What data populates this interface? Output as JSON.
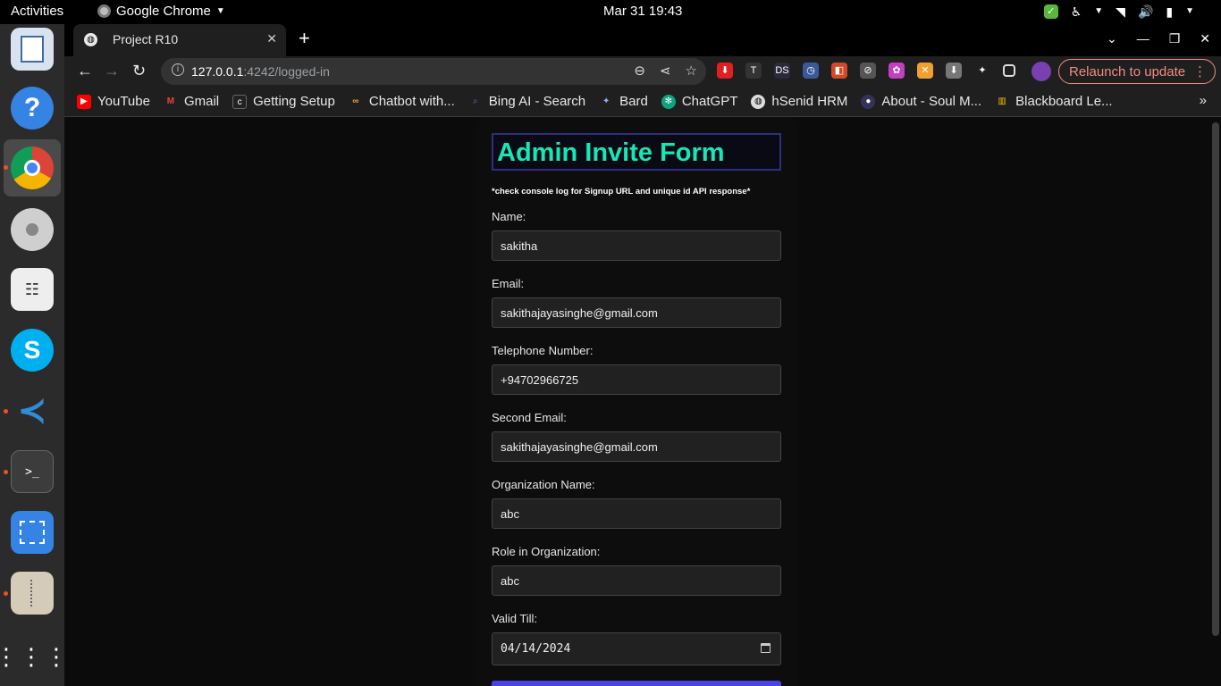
{
  "system": {
    "activities": "Activities",
    "app_name": "Google Chrome",
    "clock": "Mar 31  19:43"
  },
  "browser": {
    "tab_title": "Project R10",
    "url_host": "127.0.0.1",
    "url_path": ":4242/logged-in",
    "relaunch_label": "Relaunch to update",
    "bookmarks": [
      {
        "label": "YouTube",
        "icon": "youtube-icon",
        "color": "#ff0000"
      },
      {
        "label": "Gmail",
        "icon": "gmail-icon",
        "color": "#ea4335"
      },
      {
        "label": "Getting Setup",
        "icon": "c-icon",
        "color": "#222222"
      },
      {
        "label": "Chatbot with...",
        "icon": "infinity-icon",
        "color": "#f5a623"
      },
      {
        "label": "Bing AI - Search",
        "icon": "search-icon",
        "color": "#5b6fd8"
      },
      {
        "label": "Bard",
        "icon": "sparkle-icon",
        "color": "#8ab4f8"
      },
      {
        "label": "ChatGPT",
        "icon": "chatgpt-icon",
        "color": "#10a37f"
      },
      {
        "label": "hSenid HRM",
        "icon": "globe-icon",
        "color": "#dddddd"
      },
      {
        "label": "About - Soul M...",
        "icon": "soul-icon",
        "color": "#333355"
      },
      {
        "label": "Blackboard Le...",
        "icon": "bar-chart-icon",
        "color": "#f0c000"
      }
    ]
  },
  "form": {
    "title": "Admin Invite Form",
    "note": "*check console log for Signup URL and unique id API response*",
    "fields": [
      {
        "label": "Name:",
        "value": "sakitha"
      },
      {
        "label": "Email:",
        "value": "sakithajayasinghe@gmail.com"
      },
      {
        "label": "Telephone Number:",
        "value": "+94702966725"
      },
      {
        "label": "Second Email:",
        "value": "sakithajayasinghe@gmail.com"
      },
      {
        "label": "Organization Name:",
        "value": "abc"
      },
      {
        "label": "Role in Organization:",
        "value": "abc"
      }
    ],
    "valid_till_label": "Valid Till:",
    "valid_till_value": "04/14/2024"
  },
  "colors": {
    "title_text": "#18e6b6",
    "title_border": "#2e2f80",
    "submit_button": "#4b45e0",
    "relaunch_accent": "#f28b82"
  }
}
